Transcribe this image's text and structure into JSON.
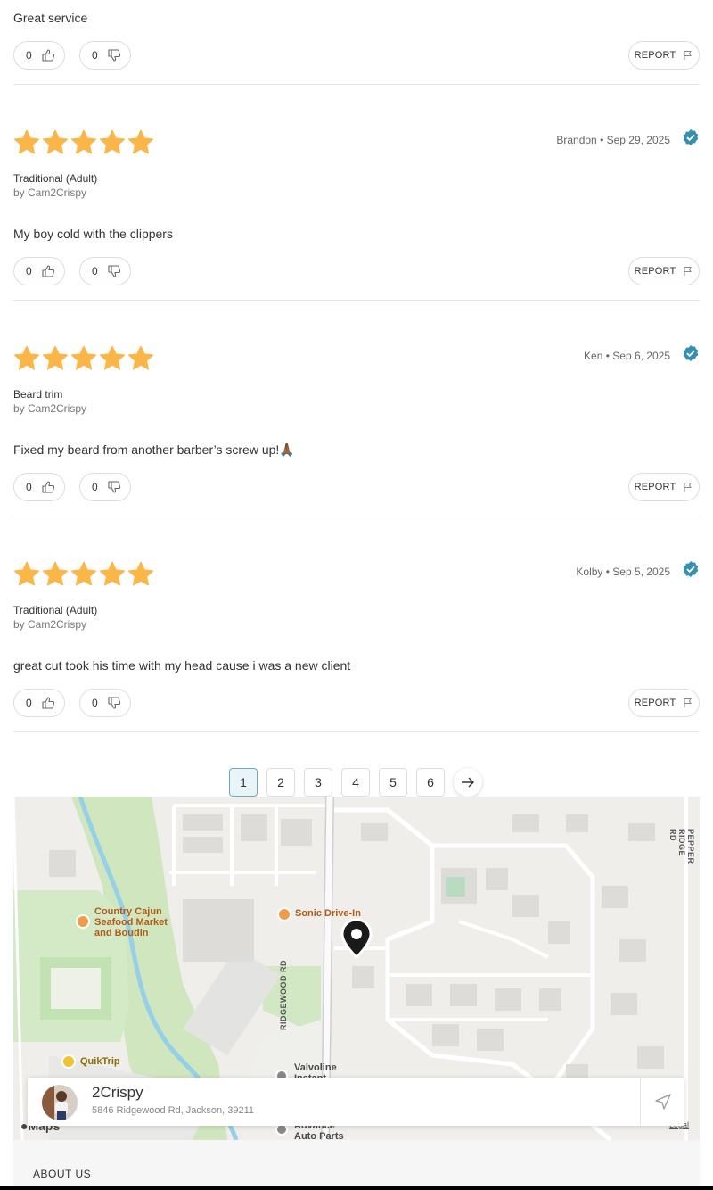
{
  "reviews": [
    {
      "text": "Great service",
      "likes": "0",
      "dislikes": "0",
      "report_label": "REPORT"
    },
    {
      "author_date": "Brandon • Sep 29, 2025",
      "rating": 5,
      "service": "Traditional (Adult)",
      "by": "by Cam2Crispy",
      "text": "My boy cold with the clippers",
      "likes": "0",
      "dislikes": "0",
      "report_label": "REPORT"
    },
    {
      "author_date": "Ken • Sep 6, 2025",
      "rating": 5,
      "service": "Beard trim",
      "by": "by Cam2Crispy",
      "text": "Fixed my beard from another barber’s screw up!🙏🏾",
      "likes": "0",
      "dislikes": "0",
      "report_label": "REPORT"
    },
    {
      "author_date": "Kolby • Sep 5, 2025",
      "rating": 5,
      "service": "Traditional (Adult)",
      "by": "by Cam2Crispy",
      "text": "great cut took his time with my head cause i was a new client",
      "likes": "0",
      "dislikes": "0",
      "report_label": "REPORT"
    }
  ],
  "pagination": {
    "pages": [
      "1",
      "2",
      "3",
      "4",
      "5",
      "6"
    ],
    "current": "1"
  },
  "map": {
    "labels": {
      "cajun": [
        "Country Cajun",
        "Seafood Market",
        "and Boudin"
      ],
      "sonic": "Sonic Drive-In",
      "quiktrip": "QuikTrip",
      "valvoline": [
        "Valvoline",
        "Instant"
      ],
      "advance": [
        "Advance",
        "Auto Parts"
      ],
      "ridgewood": "RIDGEWOOD RD",
      "pepper": "PEPPER RIDGE RD",
      "maps": "Maps",
      "legal": "Legal"
    }
  },
  "business": {
    "name": "2Crispy",
    "address": "5846 Ridgewood Rd, Jackson, 39211"
  },
  "footer": {
    "about_label": "ABOUT US"
  },
  "colors": {
    "star": "#fbb64a",
    "verified": "#3390b0",
    "active_page_bg": "#e8f4f8"
  }
}
